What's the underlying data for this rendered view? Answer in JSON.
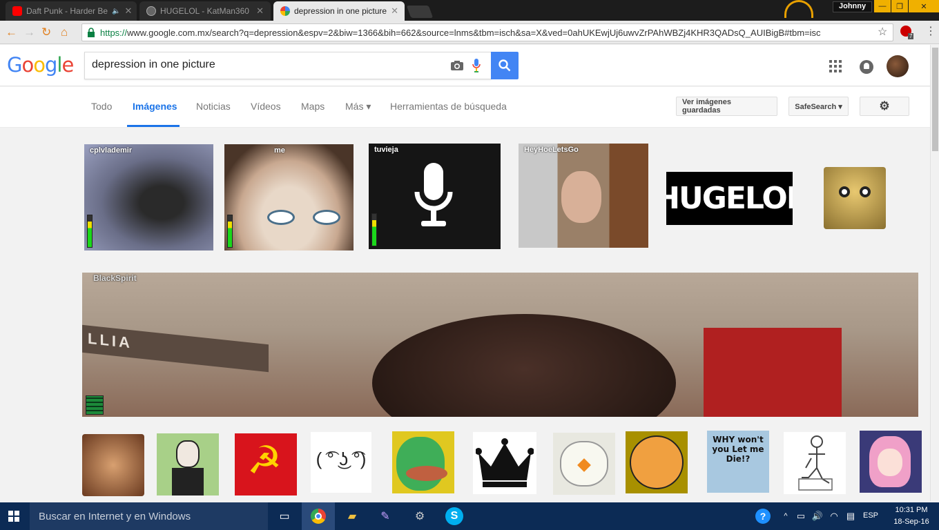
{
  "tabs": [
    {
      "title": "Daft Punk - Harder Be",
      "icon": "youtube-icon",
      "color": "#ff0000"
    },
    {
      "title": "HUGELOL - KatMan360",
      "icon": "hugelol-icon",
      "color": "#888888"
    },
    {
      "title": "depression in one picture",
      "icon": "google-icon",
      "color": "#4285f4"
    }
  ],
  "window": {
    "profile": "Johnny",
    "minimize": "—",
    "maximize": "❐",
    "close": "✕"
  },
  "omnibox": {
    "scheme": "https://",
    "url": "www.google.com.mx/search?q=depression&espv=2&biw=1366&bih=662&source=lnms&tbm=isch&sa=X&ved=0ahUKEwjUj6uwvZrPAhWBZj4KHR3QADsQ_AUIBigB#tbm=isc",
    "extension_badge": "7"
  },
  "google": {
    "logo": "Google",
    "query": "depression in one picture",
    "nav_tabs": [
      "Todo",
      "Imágenes",
      "Noticias",
      "Vídeos",
      "Maps",
      "Más ▾",
      "Herramientas de búsqueda"
    ],
    "active_tab": "Imágenes",
    "saved_button": "Ver imágenes guardadas",
    "safesearch": "SafeSearch ▾"
  },
  "thumbnails": {
    "row1": [
      {
        "label": "cplvlademir"
      },
      {
        "label": "me"
      },
      {
        "label": "tuvieja"
      },
      {
        "label": "HeyHoeLetsGo"
      },
      {
        "label": "HUGELOL"
      },
      {
        "label": ""
      }
    ],
    "big_label": "BlackSpirit",
    "big_sign": "LLIA",
    "bottom_text": "WHY won't you Let me Die!?"
  },
  "taskbar": {
    "search": "Buscar en Internet y en Windows",
    "lang": "ESP",
    "time": "10:31 PM",
    "date": "18-Sep-16"
  },
  "colors": {
    "google_blue": "#4285f4",
    "taskbar": "#0c2b55",
    "accent_orange": "#ffb000"
  }
}
